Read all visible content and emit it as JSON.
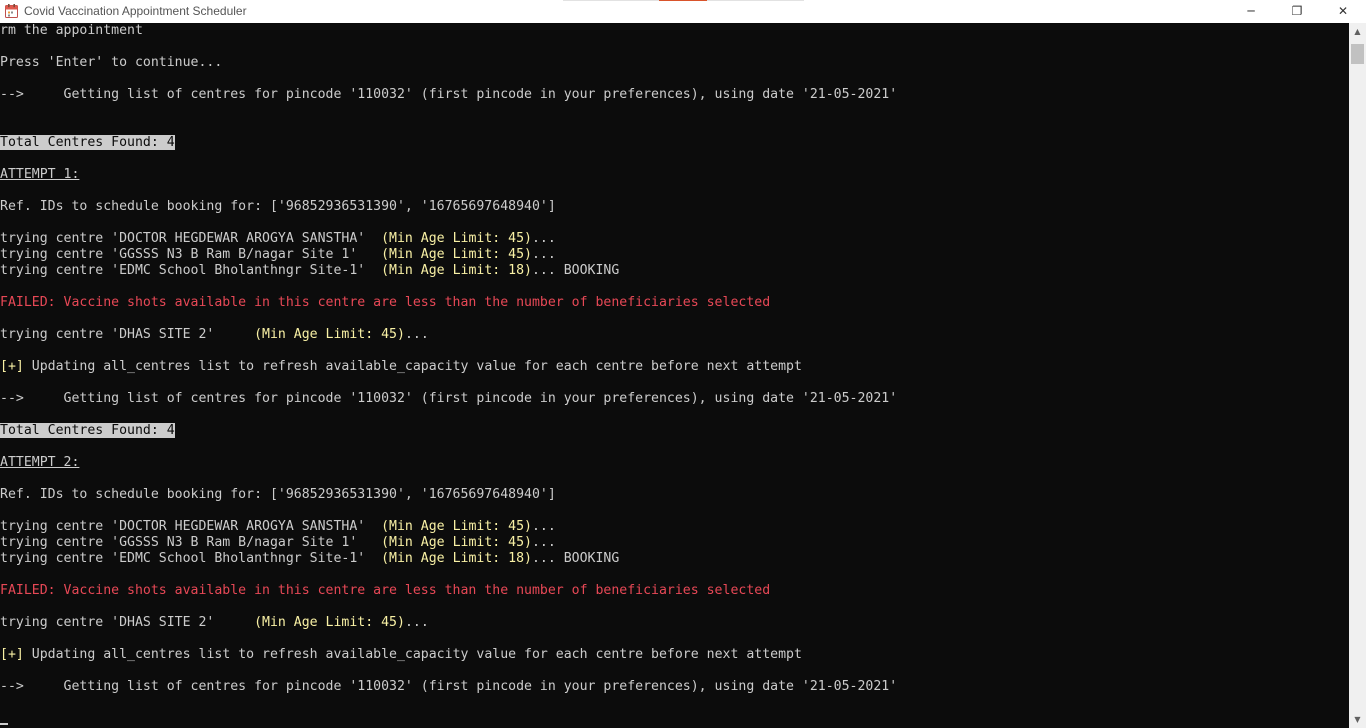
{
  "window": {
    "title": "Covid Vaccination Appointment Scheduler",
    "minimize_glyph": "─",
    "maximize_glyph": "❐",
    "close_glyph": "✕",
    "app_icon": "calendar-icon"
  },
  "colors": {
    "console_bg": "#0c0c0c",
    "console_text": "#cccccc",
    "yellow": "#f9f1a5",
    "red": "#e74856",
    "accent": "#d9542b"
  },
  "scrollbar": {
    "up_glyph": "▲",
    "down_glyph": "▼"
  },
  "console": {
    "lines": [
      {
        "segments": [
          {
            "text": "rm the appointment",
            "style": "default"
          }
        ]
      },
      {
        "segments": [
          {
            "text": "Press 'Enter' to continue...",
            "style": "default"
          }
        ]
      },
      {
        "segments": [
          {
            "text": "-->     Getting list of centres for pincode '110032' (first pincode in your preferences), using date '21-05-2021'",
            "style": "default"
          }
        ]
      },
      {
        "segments": [
          {
            "text": "Total Centres Found: 4",
            "style": "inverse"
          }
        ]
      },
      {
        "segments": [
          {
            "text": "ATTEMPT 1:",
            "style": "underline"
          }
        ]
      },
      {
        "segments": [
          {
            "text": "Ref. IDs to schedule booking for: ['96852936531390', '16765697648940']",
            "style": "default"
          }
        ]
      },
      {
        "segments": [
          {
            "text": "trying centre 'DOCTOR HEGDEWAR AROGYA SANSTHA'  ",
            "style": "default"
          },
          {
            "text": "(Min Age Limit: 45)",
            "style": "yellow"
          },
          {
            "text": "...",
            "style": "default"
          }
        ]
      },
      {
        "segments": [
          {
            "text": "trying centre 'GGSSS N3 B Ram B/nagar Site 1'   ",
            "style": "default"
          },
          {
            "text": "(Min Age Limit: 45)",
            "style": "yellow"
          },
          {
            "text": "...",
            "style": "default"
          }
        ]
      },
      {
        "segments": [
          {
            "text": "trying centre 'EDMC School Bholanthngr Site-1'  ",
            "style": "default"
          },
          {
            "text": "(Min Age Limit: 18)",
            "style": "yellow"
          },
          {
            "text": "... BOOKING",
            "style": "default"
          }
        ]
      },
      {
        "segments": [
          {
            "text": "FAILED: Vaccine shots available in this centre are less than the number of beneficiaries selected",
            "style": "red"
          }
        ]
      },
      {
        "segments": [
          {
            "text": "trying centre 'DHAS SITE 2'     ",
            "style": "default"
          },
          {
            "text": "(Min Age Limit: 45)",
            "style": "yellow"
          },
          {
            "text": "...",
            "style": "default"
          }
        ]
      },
      {
        "segments": [
          {
            "text": "[+]",
            "style": "yellow"
          },
          {
            "text": " Updating all_centres list to refresh available_capacity value for each centre before next attempt",
            "style": "default"
          }
        ]
      },
      {
        "segments": [
          {
            "text": "-->     Getting list of centres for pincode '110032' (first pincode in your preferences), using date '21-05-2021'",
            "style": "default"
          }
        ]
      },
      {
        "segments": [
          {
            "text": "Total Centres Found: 4",
            "style": "inverse"
          }
        ]
      },
      {
        "segments": [
          {
            "text": "ATTEMPT 2:",
            "style": "underline"
          }
        ]
      },
      {
        "segments": [
          {
            "text": "Ref. IDs to schedule booking for: ['96852936531390', '16765697648940']",
            "style": "default"
          }
        ]
      },
      {
        "segments": [
          {
            "text": "trying centre 'DOCTOR HEGDEWAR AROGYA SANSTHA'  ",
            "style": "default"
          },
          {
            "text": "(Min Age Limit: 45)",
            "style": "yellow"
          },
          {
            "text": "...",
            "style": "default"
          }
        ]
      },
      {
        "segments": [
          {
            "text": "trying centre 'GGSSS N3 B Ram B/nagar Site 1'   ",
            "style": "default"
          },
          {
            "text": "(Min Age Limit: 45)",
            "style": "yellow"
          },
          {
            "text": "...",
            "style": "default"
          }
        ]
      },
      {
        "segments": [
          {
            "text": "trying centre 'EDMC School Bholanthngr Site-1'  ",
            "style": "default"
          },
          {
            "text": "(Min Age Limit: 18)",
            "style": "yellow"
          },
          {
            "text": "... BOOKING",
            "style": "default"
          }
        ]
      },
      {
        "segments": [
          {
            "text": "FAILED: Vaccine shots available in this centre are less than the number of beneficiaries selected",
            "style": "red"
          }
        ]
      },
      {
        "segments": [
          {
            "text": "trying centre 'DHAS SITE 2'     ",
            "style": "default"
          },
          {
            "text": "(Min Age Limit: 45)",
            "style": "yellow"
          },
          {
            "text": "...",
            "style": "default"
          }
        ]
      },
      {
        "segments": [
          {
            "text": "[+]",
            "style": "yellow"
          },
          {
            "text": " Updating all_centres list to refresh available_capacity value for each centre before next attempt",
            "style": "default"
          }
        ]
      },
      {
        "segments": [
          {
            "text": "-->     Getting list of centres for pincode '110032' (first pincode in your preferences), using date '21-05-2021'",
            "style": "default"
          }
        ]
      }
    ]
  }
}
